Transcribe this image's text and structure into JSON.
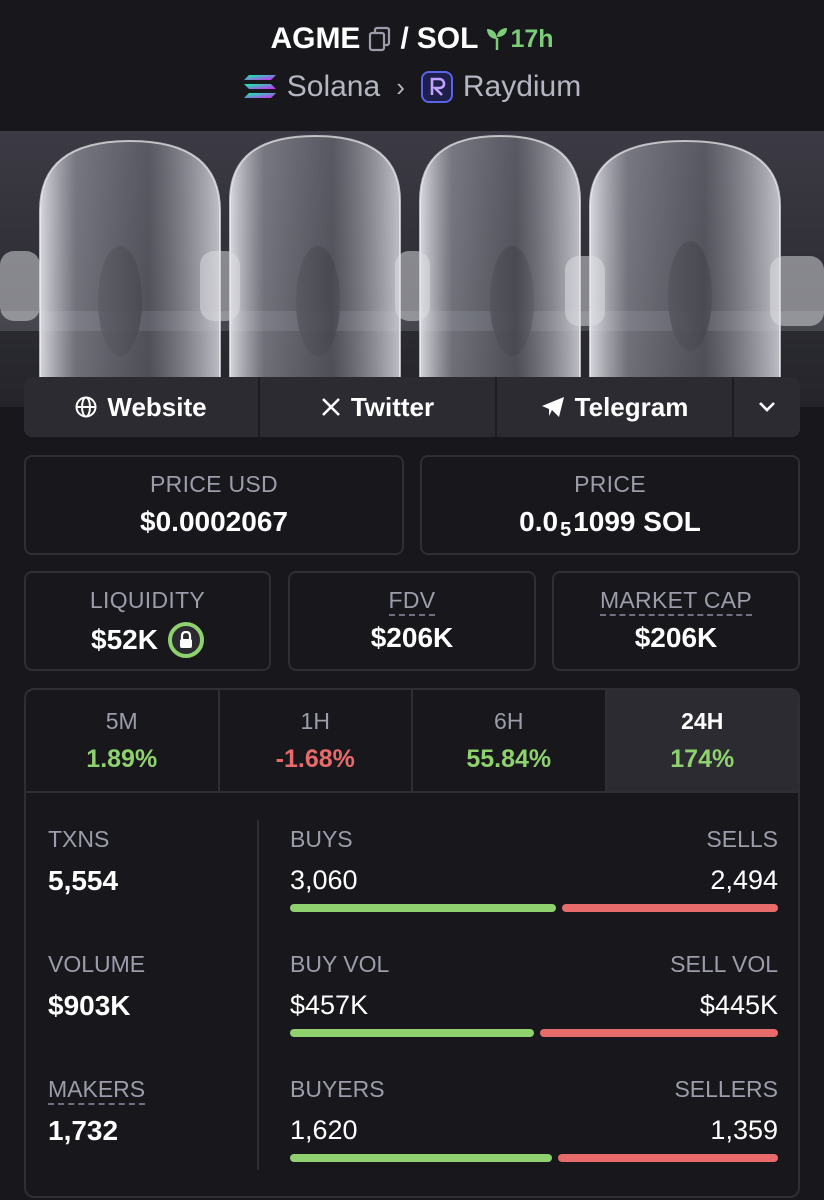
{
  "header": {
    "base": "AGME",
    "separator": "/",
    "quote": "SOL",
    "age": "17h",
    "chain": "Solana",
    "dex": "Raydium"
  },
  "links": [
    "Website",
    "Twitter",
    "Telegram"
  ],
  "price_usd": {
    "label": "PRICE USD",
    "value": "$0.0002067"
  },
  "price_native": {
    "label": "PRICE",
    "prefix": "0.0",
    "subscript": "5",
    "suffix": "1099 SOL"
  },
  "liquidity": {
    "label": "LIQUIDITY",
    "value": "$52K"
  },
  "fdv": {
    "label": "FDV",
    "value": "$206K"
  },
  "market_cap": {
    "label": "MARKET CAP",
    "value": "$206K"
  },
  "tabs": [
    {
      "label": "5M",
      "value": "1.89%"
    },
    {
      "label": "1H",
      "value": "-1.68%"
    },
    {
      "label": "6H",
      "value": "55.84%"
    },
    {
      "label": "24H",
      "value": "174%"
    }
  ],
  "txns": {
    "label": "TXNS",
    "value": "5,554"
  },
  "volume": {
    "label": "VOLUME",
    "value": "$903K"
  },
  "makers": {
    "label": "MAKERS",
    "value": "1,732"
  },
  "buys_sells": {
    "left_label": "BUYS",
    "right_label": "SELLS",
    "left_value": "3,060",
    "right_value": "2,494",
    "left_fraction": 0.551
  },
  "vol_split": {
    "left_label": "BUY VOL",
    "right_label": "SELL VOL",
    "left_value": "$457K",
    "right_value": "$445K",
    "left_fraction": 0.507
  },
  "buyers_sellers": {
    "left_label": "BUYERS",
    "right_label": "SELLERS",
    "left_value": "1,620",
    "right_value": "1,359",
    "left_fraction": 0.544
  },
  "colors": {
    "positive": "#8ed16e",
    "negative": "#e86b6b",
    "background": "#17171c"
  }
}
